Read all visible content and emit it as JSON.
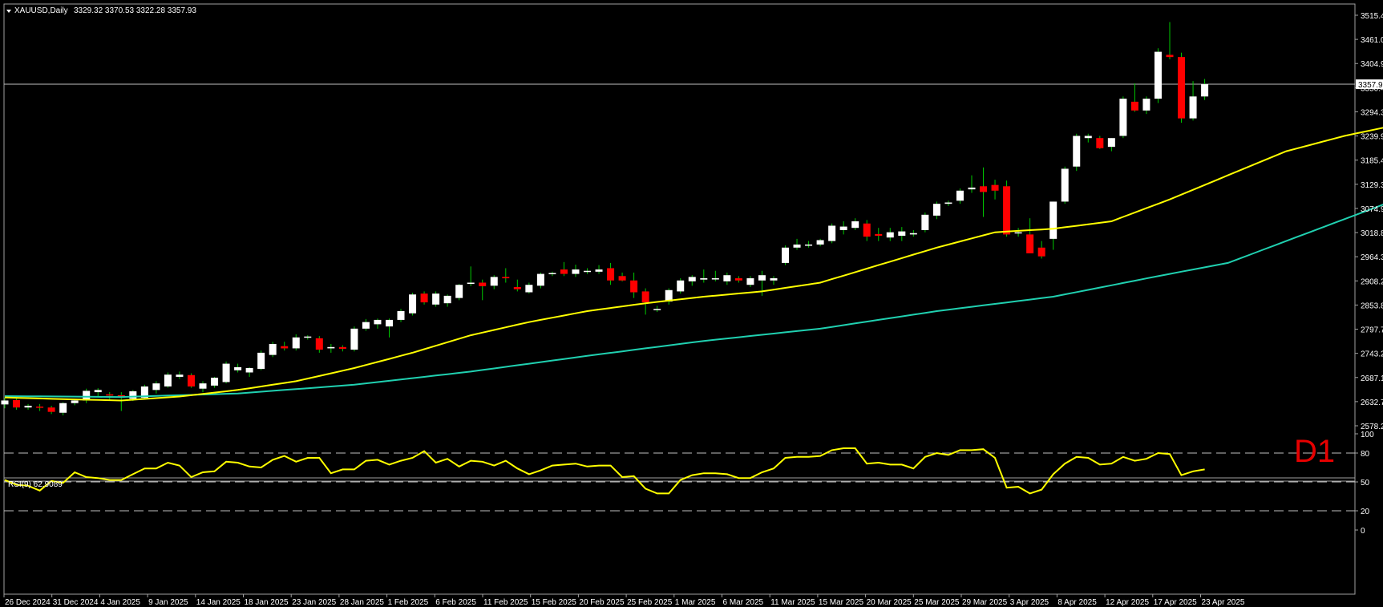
{
  "header": {
    "symbol_line": "XAUUSD,Daily",
    "ohlc": "3329.32 3370.53 3322.28 3357.93"
  },
  "price_axis": {
    "ticks": [
      "3515.45",
      "3461.00",
      "3404.90",
      "3350.45",
      "3294.35",
      "3239.90",
      "3185.45",
      "3129.35",
      "3074.90",
      "3018.80",
      "2964.35",
      "2908.25",
      "2853.80",
      "2797.70",
      "2743.25",
      "2687.15",
      "2632.70",
      "2578.25"
    ],
    "current_price": "3357.93"
  },
  "rsi_panel": {
    "label": "RSI(9) 62.9089",
    "ticks": [
      "100",
      "80",
      "50",
      "20",
      "0"
    ]
  },
  "time_axis": {
    "labels": [
      "26 Dec 2024",
      "31 Dec 2024",
      "4 Jan 2025",
      "9 Jan 2025",
      "14 Jan 2025",
      "18 Jan 2025",
      "23 Jan 2025",
      "28 Jan 2025",
      "1 Feb 2025",
      "6 Feb 2025",
      "11 Feb 2025",
      "15 Feb 2025",
      "20 Feb 2025",
      "25 Feb 2025",
      "1 Mar 2025",
      "6 Mar 2025",
      "11 Mar 2025",
      "15 Mar 2025",
      "20 Mar 2025",
      "25 Mar 2025",
      "29 Mar 2025",
      "3 Apr 2025",
      "8 Apr 2025",
      "12 Apr 2025",
      "17 Apr 2025",
      "23 Apr 2025"
    ]
  },
  "watermark": "D1",
  "colors": {
    "background": "#000000",
    "bull_candle": "#ffffff",
    "bear_candle": "#ff0000",
    "wick": "#00c800",
    "ma_fast": "#ffff00",
    "ma_slow": "#20d0b0",
    "rsi_line": "#ffff00",
    "grid_line": "#c0c0c0",
    "current_price_line": "#c0c0c0"
  },
  "chart_data": {
    "type": "candlestick",
    "symbol": "XAUUSD",
    "timeframe": "Daily",
    "ylim": [
      2578.25,
      3540
    ],
    "candles": [
      [
        2627,
        2642,
        2618,
        2636
      ],
      [
        2637,
        2640,
        2615,
        2620
      ],
      [
        2620,
        2628,
        2615,
        2624
      ],
      [
        2622,
        2628,
        2612,
        2620
      ],
      [
        2620,
        2624,
        2605,
        2610
      ],
      [
        2608,
        2632,
        2602,
        2630
      ],
      [
        2630,
        2640,
        2625,
        2636
      ],
      [
        2636,
        2663,
        2630,
        2658
      ],
      [
        2655,
        2664,
        2645,
        2660
      ],
      [
        2650,
        2655,
        2638,
        2648
      ],
      [
        2648,
        2655,
        2612,
        2645
      ],
      [
        2640,
        2660,
        2635,
        2657
      ],
      [
        2642,
        2672,
        2640,
        2668
      ],
      [
        2660,
        2680,
        2652,
        2675
      ],
      [
        2668,
        2700,
        2665,
        2695
      ],
      [
        2690,
        2702,
        2685,
        2695
      ],
      [
        2694,
        2698,
        2665,
        2668
      ],
      [
        2663,
        2680,
        2655,
        2675
      ],
      [
        2670,
        2690,
        2665,
        2688
      ],
      [
        2678,
        2725,
        2675,
        2720
      ],
      [
        2705,
        2720,
        2700,
        2712
      ],
      [
        2700,
        2712,
        2690,
        2710
      ],
      [
        2708,
        2750,
        2705,
        2745
      ],
      [
        2740,
        2770,
        2735,
        2765
      ],
      [
        2760,
        2770,
        2750,
        2755
      ],
      [
        2755,
        2787,
        2750,
        2780
      ],
      [
        2780,
        2785,
        2775,
        2782
      ],
      [
        2778,
        2783,
        2745,
        2752
      ],
      [
        2755,
        2765,
        2745,
        2758
      ],
      [
        2758,
        2762,
        2748,
        2754
      ],
      [
        2752,
        2805,
        2748,
        2800
      ],
      [
        2800,
        2822,
        2795,
        2815
      ],
      [
        2810,
        2823,
        2800,
        2820
      ],
      [
        2805,
        2823,
        2780,
        2820
      ],
      [
        2820,
        2845,
        2815,
        2840
      ],
      [
        2835,
        2882,
        2830,
        2878
      ],
      [
        2880,
        2885,
        2855,
        2860
      ],
      [
        2855,
        2885,
        2850,
        2880
      ],
      [
        2858,
        2878,
        2850,
        2875
      ],
      [
        2870,
        2902,
        2865,
        2900
      ],
      [
        2903,
        2942,
        2897,
        2905
      ],
      [
        2905,
        2912,
        2865,
        2897
      ],
      [
        2898,
        2922,
        2890,
        2918
      ],
      [
        2918,
        2938,
        2905,
        2915
      ],
      [
        2895,
        2912,
        2885,
        2890
      ],
      [
        2883,
        2905,
        2880,
        2900
      ],
      [
        2898,
        2928,
        2892,
        2925
      ],
      [
        2925,
        2930,
        2920,
        2927
      ],
      [
        2935,
        2952,
        2920,
        2925
      ],
      [
        2925,
        2946,
        2918,
        2935
      ],
      [
        2930,
        2938,
        2925,
        2932
      ],
      [
        2930,
        2945,
        2925,
        2935
      ],
      [
        2938,
        2950,
        2900,
        2910
      ],
      [
        2920,
        2928,
        2908,
        2910
      ],
      [
        2910,
        2928,
        2870,
        2883
      ],
      [
        2885,
        2892,
        2832,
        2860
      ],
      [
        2845,
        2852,
        2838,
        2845
      ],
      [
        2862,
        2892,
        2855,
        2888
      ],
      [
        2885,
        2915,
        2880,
        2910
      ],
      [
        2908,
        2922,
        2898,
        2918
      ],
      [
        2912,
        2935,
        2905,
        2915
      ],
      [
        2915,
        2932,
        2908,
        2915
      ],
      [
        2908,
        2928,
        2900,
        2922
      ],
      [
        2915,
        2920,
        2905,
        2910
      ],
      [
        2900,
        2920,
        2895,
        2915
      ],
      [
        2910,
        2932,
        2875,
        2922
      ],
      [
        2910,
        2920,
        2900,
        2915
      ],
      [
        2950,
        2990,
        2945,
        2985
      ],
      [
        2985,
        3005,
        2980,
        2992
      ],
      [
        2990,
        3000,
        2985,
        2992
      ],
      [
        2992,
        3005,
        2988,
        3002
      ],
      [
        3000,
        3040,
        2995,
        3035
      ],
      [
        3025,
        3045,
        3015,
        3033
      ],
      [
        3030,
        3052,
        3025,
        3045
      ],
      [
        3040,
        3048,
        3000,
        3010
      ],
      [
        3016,
        3030,
        3000,
        3012
      ],
      [
        3008,
        3030,
        3000,
        3020
      ],
      [
        3012,
        3032,
        3000,
        3022
      ],
      [
        3015,
        3025,
        3010,
        3018
      ],
      [
        3025,
        3065,
        3020,
        3060
      ],
      [
        3058,
        3090,
        3050,
        3085
      ],
      [
        3085,
        3092,
        3080,
        3088
      ],
      [
        3092,
        3120,
        3085,
        3115
      ],
      [
        3118,
        3150,
        3110,
        3122
      ],
      [
        3125,
        3168,
        3055,
        3112
      ],
      [
        3128,
        3140,
        3095,
        3115
      ],
      [
        3125,
        3138,
        3010,
        3015
      ],
      [
        3018,
        3030,
        3010,
        3020
      ],
      [
        3015,
        3052,
        2982,
        2972
      ],
      [
        2985,
        3000,
        2960,
        2965
      ],
      [
        3005,
        3090,
        2980,
        3090
      ],
      [
        3090,
        3170,
        3085,
        3165
      ],
      [
        3170,
        3245,
        3160,
        3240
      ],
      [
        3235,
        3245,
        3225,
        3240
      ],
      [
        3235,
        3240,
        3210,
        3212
      ],
      [
        3215,
        3235,
        3205,
        3235
      ],
      [
        3240,
        3330,
        3235,
        3325
      ],
      [
        3318,
        3360,
        3295,
        3298
      ],
      [
        3298,
        3330,
        3290,
        3325
      ],
      [
        3325,
        3440,
        3315,
        3432
      ],
      [
        3425,
        3500,
        3415,
        3420
      ],
      [
        3420,
        3430,
        3270,
        3280
      ],
      [
        3280,
        3365,
        3275,
        3330
      ],
      [
        3330,
        3370,
        3322,
        3358
      ]
    ],
    "ma_fast": [
      [
        0,
        2643
      ],
      [
        5,
        2639
      ],
      [
        10,
        2636
      ],
      [
        15,
        2645
      ],
      [
        20,
        2660
      ],
      [
        25,
        2680
      ],
      [
        30,
        2710
      ],
      [
        35,
        2745
      ],
      [
        40,
        2785
      ],
      [
        45,
        2815
      ],
      [
        50,
        2840
      ],
      [
        55,
        2858
      ],
      [
        60,
        2873
      ],
      [
        65,
        2885
      ],
      [
        70,
        2905
      ],
      [
        75,
        2945
      ],
      [
        80,
        2985
      ],
      [
        85,
        3020
      ],
      [
        90,
        3028
      ],
      [
        95,
        3045
      ],
      [
        100,
        3095
      ],
      [
        105,
        3150
      ],
      [
        110,
        3205
      ],
      [
        115,
        3240
      ],
      [
        120,
        3268
      ]
    ],
    "ma_slow": [
      [
        0,
        2646
      ],
      [
        10,
        2644
      ],
      [
        20,
        2652
      ],
      [
        30,
        2672
      ],
      [
        40,
        2702
      ],
      [
        50,
        2738
      ],
      [
        60,
        2772
      ],
      [
        70,
        2800
      ],
      [
        80,
        2840
      ],
      [
        90,
        2873
      ],
      [
        100,
        2925
      ],
      [
        105,
        2950
      ],
      [
        110,
        3000
      ],
      [
        115,
        3050
      ],
      [
        120,
        3100
      ]
    ],
    "rsi": [
      52,
      47,
      46,
      41,
      51,
      49,
      60,
      55,
      54,
      52,
      52,
      58,
      64,
      64,
      70,
      67,
      55,
      60,
      61,
      71,
      70,
      66,
      65,
      73,
      77,
      71,
      75,
      75,
      59,
      63,
      63,
      72,
      73,
      68,
      72,
      75,
      82,
      70,
      74,
      66,
      72,
      71,
      67,
      72,
      64,
      58,
      62,
      67,
      68,
      69,
      66,
      67,
      67,
      55,
      56,
      43,
      38,
      38,
      52,
      57,
      59,
      59,
      58,
      54,
      54,
      60,
      64,
      75,
      76,
      76,
      77,
      83,
      85,
      85,
      69,
      70,
      68,
      68,
      64,
      76,
      80,
      78,
      83,
      83,
      84,
      75,
      44,
      45,
      38,
      42,
      58,
      69,
      76,
      75,
      68,
      69,
      76,
      72,
      74,
      80,
      79,
      57,
      61,
      63
    ],
    "rsi_levels": [
      20,
      50,
      80
    ],
    "rsi_ylim": [
      0,
      100
    ]
  }
}
